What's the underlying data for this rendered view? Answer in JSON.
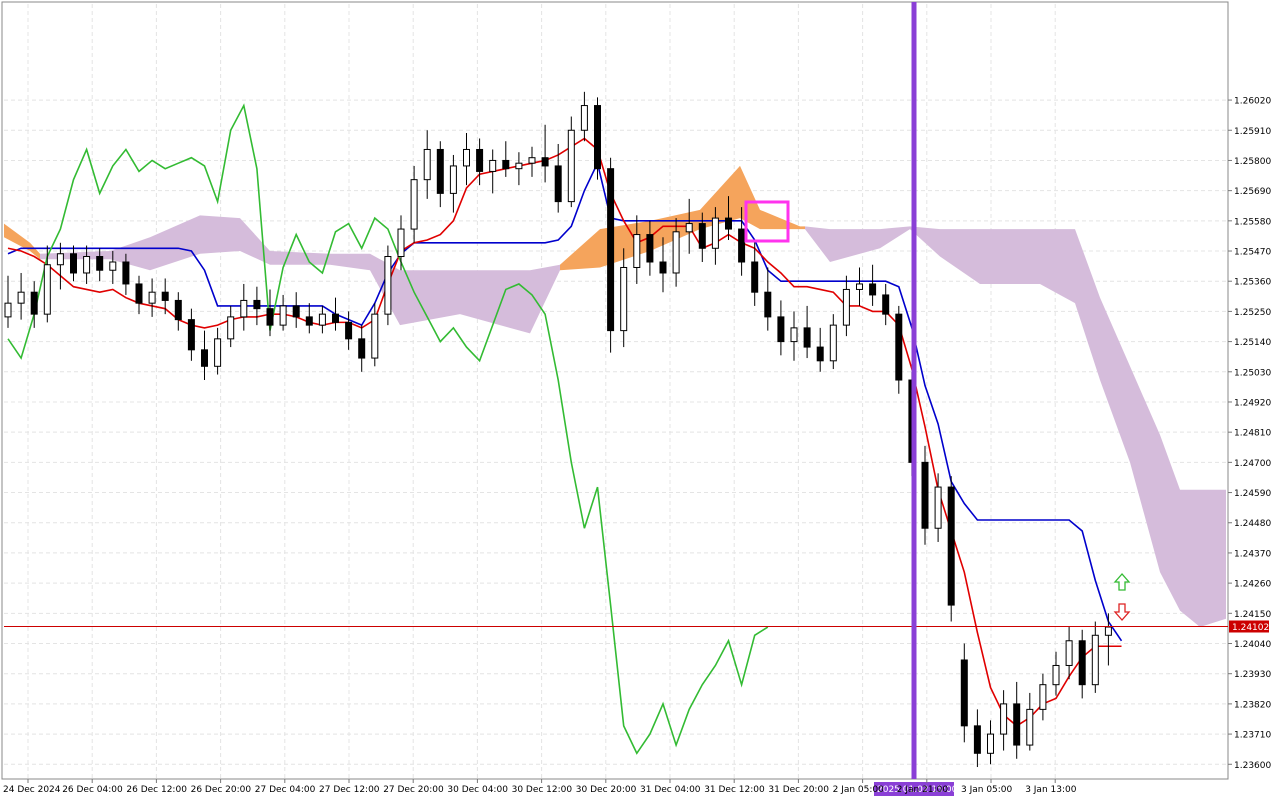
{
  "chart_data": {
    "type": "candlestick",
    "indicator": "Ichimoku Kinko Hyo",
    "grid": true,
    "ylim": [
      1.2355,
      1.2637
    ],
    "y_ticks": [
      "1.26020",
      "1.25910",
      "1.25800",
      "1.25690",
      "1.25580",
      "1.25470",
      "1.25360",
      "1.25250",
      "1.25140",
      "1.25030",
      "1.24920",
      "1.24810",
      "1.24700",
      "1.24590",
      "1.24480",
      "1.24370",
      "1.24260",
      "1.24150",
      "1.24040",
      "1.23930",
      "1.23820",
      "1.23710",
      "1.23600"
    ],
    "x_ticks": [
      "24 Dec 2024",
      "26 Dec 04:00",
      "26 Dec 12:00",
      "26 Dec 20:00",
      "27 Dec 04:00",
      "27 Dec 12:00",
      "27 Dec 20:00",
      "30 Dec 04:00",
      "30 Dec 12:00",
      "30 Dec 20:00",
      "31 Dec 04:00",
      "31 Dec 12:00",
      "31 Dec 20:00",
      "2 Jan 05:00",
      "2 Jan 21:00",
      "3 Jan 05:00",
      "3 Jan 13:00"
    ],
    "current_price": {
      "label": "1.24102",
      "value": 1.24102,
      "color": "#cc0000"
    },
    "vertical_marker": {
      "label": "2025.01.02 15:00",
      "color": "#8a3fd6"
    },
    "highlight_box_color": "#ff33ee",
    "series_colors": {
      "tenkan_sen": "#e00000",
      "kijun_sen": "#0000cc",
      "chikou_span": "#33bb33",
      "kumo_bearish": "#d5bcdb",
      "kumo_bullish": "#f5a45c",
      "candle_bull": "#ffffff",
      "candle_bear": "#000000"
    },
    "arrows": {
      "up_color": "#33bb33",
      "down_color": "#dd2222"
    },
    "candles": [
      [
        1.2523,
        1.2538,
        1.2519,
        1.2528
      ],
      [
        1.2528,
        1.2539,
        1.2522,
        1.2532
      ],
      [
        1.2532,
        1.2536,
        1.2519,
        1.2524
      ],
      [
        1.2524,
        1.2549,
        1.2521,
        1.2542
      ],
      [
        1.2542,
        1.255,
        1.2533,
        1.2546
      ],
      [
        1.2546,
        1.2549,
        1.2536,
        1.2539
      ],
      [
        1.2539,
        1.2549,
        1.2535,
        1.2545
      ],
      [
        1.2545,
        1.2548,
        1.2536,
        1.254
      ],
      [
        1.254,
        1.2547,
        1.2535,
        1.2543
      ],
      [
        1.2543,
        1.2546,
        1.2531,
        1.2535
      ],
      [
        1.2535,
        1.2538,
        1.2524,
        1.2528
      ],
      [
        1.2528,
        1.2537,
        1.2523,
        1.2532
      ],
      [
        1.2532,
        1.2537,
        1.2524,
        1.2529
      ],
      [
        1.2529,
        1.2532,
        1.2518,
        1.2522
      ],
      [
        1.2522,
        1.2526,
        1.2507,
        1.2511
      ],
      [
        1.2511,
        1.2518,
        1.25,
        1.2505
      ],
      [
        1.2505,
        1.2519,
        1.2502,
        1.2515
      ],
      [
        1.2515,
        1.2527,
        1.2512,
        1.2523
      ],
      [
        1.2523,
        1.2535,
        1.2518,
        1.2529
      ],
      [
        1.2529,
        1.2534,
        1.252,
        1.2526
      ],
      [
        1.2526,
        1.2533,
        1.2516,
        1.252
      ],
      [
        1.252,
        1.2531,
        1.2518,
        1.2527
      ],
      [
        1.2527,
        1.2532,
        1.2519,
        1.2523
      ],
      [
        1.2523,
        1.2528,
        1.2517,
        1.252
      ],
      [
        1.252,
        1.2527,
        1.2517,
        1.2524
      ],
      [
        1.2524,
        1.253,
        1.2518,
        1.2521
      ],
      [
        1.2521,
        1.2525,
        1.2511,
        1.2515
      ],
      [
        1.2515,
        1.252,
        1.2503,
        1.2508
      ],
      [
        1.2508,
        1.2528,
        1.2505,
        1.2524
      ],
      [
        1.2524,
        1.2549,
        1.252,
        1.2545
      ],
      [
        1.2545,
        1.256,
        1.254,
        1.2555
      ],
      [
        1.2555,
        1.2578,
        1.255,
        1.2573
      ],
      [
        1.2573,
        1.2591,
        1.2566,
        1.2584
      ],
      [
        1.2584,
        1.2587,
        1.2563,
        1.2568
      ],
      [
        1.2568,
        1.2582,
        1.2561,
        1.2578
      ],
      [
        1.2578,
        1.259,
        1.2571,
        1.2584
      ],
      [
        1.2584,
        1.2588,
        1.2571,
        1.2576
      ],
      [
        1.2576,
        1.2584,
        1.2568,
        1.258
      ],
      [
        1.258,
        1.2587,
        1.2574,
        1.2577
      ],
      [
        1.2577,
        1.2583,
        1.2571,
        1.2579
      ],
      [
        1.2579,
        1.2585,
        1.2574,
        1.2581
      ],
      [
        1.2581,
        1.2593,
        1.2572,
        1.2578
      ],
      [
        1.2578,
        1.2586,
        1.2561,
        1.2565
      ],
      [
        1.2565,
        1.2596,
        1.2563,
        1.2591
      ],
      [
        1.2591,
        1.2605,
        1.2587,
        1.26
      ],
      [
        1.26,
        1.2603,
        1.2573,
        1.2577
      ],
      [
        1.2577,
        1.2581,
        1.251,
        1.2518
      ],
      [
        1.2518,
        1.2548,
        1.2512,
        1.2541
      ],
      [
        1.2541,
        1.256,
        1.2535,
        1.2553
      ],
      [
        1.2553,
        1.2558,
        1.2538,
        1.2543
      ],
      [
        1.2543,
        1.2552,
        1.2532,
        1.2539
      ],
      [
        1.2539,
        1.2559,
        1.2534,
        1.2554
      ],
      [
        1.2554,
        1.2566,
        1.2546,
        1.2557
      ],
      [
        1.2557,
        1.2561,
        1.2543,
        1.2548
      ],
      [
        1.2548,
        1.2563,
        1.2542,
        1.2559
      ],
      [
        1.2559,
        1.2567,
        1.2551,
        1.2555
      ],
      [
        1.2555,
        1.2563,
        1.2538,
        1.2543
      ],
      [
        1.2543,
        1.2551,
        1.2527,
        1.2532
      ],
      [
        1.2532,
        1.2541,
        1.2518,
        1.2523
      ],
      [
        1.2523,
        1.2529,
        1.2509,
        1.2514
      ],
      [
        1.2514,
        1.2525,
        1.2507,
        1.2519
      ],
      [
        1.2519,
        1.2527,
        1.2508,
        1.2512
      ],
      [
        1.2512,
        1.2519,
        1.2503,
        1.2507
      ],
      [
        1.2507,
        1.2524,
        1.2504,
        1.252
      ],
      [
        1.252,
        1.2538,
        1.2516,
        1.2533
      ],
      [
        1.2533,
        1.2541,
        1.2527,
        1.2535
      ],
      [
        1.2535,
        1.2542,
        1.2527,
        1.2531
      ],
      [
        1.2531,
        1.2535,
        1.252,
        1.2524
      ],
      [
        1.2524,
        1.2527,
        1.2495,
        1.25
      ],
      [
        1.25,
        1.2503,
        1.2465,
        1.247
      ],
      [
        1.247,
        1.2476,
        1.244,
        1.2446
      ],
      [
        1.2446,
        1.2466,
        1.2441,
        1.2461
      ],
      [
        1.2461,
        1.2465,
        1.2412,
        1.2418
      ],
      [
        1.2398,
        1.2404,
        1.2368,
        1.2374
      ],
      [
        1.2374,
        1.238,
        1.2359,
        1.2364
      ],
      [
        1.2364,
        1.2376,
        1.236,
        1.2371
      ],
      [
        1.2371,
        1.2387,
        1.2365,
        1.2382
      ],
      [
        1.2382,
        1.239,
        1.2362,
        1.2367
      ],
      [
        1.2367,
        1.2386,
        1.2365,
        1.238
      ],
      [
        1.238,
        1.2393,
        1.2376,
        1.2389
      ],
      [
        1.2389,
        1.2401,
        1.2385,
        1.2396
      ],
      [
        1.2396,
        1.241,
        1.2391,
        1.2405
      ],
      [
        1.2405,
        1.2409,
        1.2384,
        1.2389
      ],
      [
        1.2389,
        1.2412,
        1.2386,
        1.2407
      ],
      [
        1.2407,
        1.2415,
        1.2396,
        1.241
      ]
    ],
    "tenkan_sen": [
      1.2548,
      1.2547,
      1.2545,
      1.2542,
      1.2538,
      1.2534,
      1.2533,
      1.2532,
      1.2533,
      1.253,
      1.2528,
      1.2527,
      1.2526,
      1.2522,
      1.252,
      1.2519,
      1.252,
      1.2522,
      1.2523,
      1.2523,
      1.2524,
      1.2524,
      1.2523,
      1.2521,
      1.252,
      1.2521,
      1.2521,
      1.2519,
      1.2522,
      1.2535,
      1.2547,
      1.255,
      1.2551,
      1.2553,
      1.2558,
      1.257,
      1.2575,
      1.2576,
      1.2577,
      1.2578,
      1.2579,
      1.258,
      1.2582,
      1.2585,
      1.2588,
      1.2584,
      1.2568,
      1.2558,
      1.255,
      1.2552,
      1.2556,
      1.2556,
      1.2556,
      1.2548,
      1.255,
      1.2553,
      1.255,
      1.2548,
      1.2543,
      1.2539,
      1.2534,
      1.2534,
      1.2533,
      1.2532,
      1.2527,
      1.2527,
      1.2525,
      1.2525,
      1.252,
      1.2504,
      1.2483,
      1.246,
      1.2445,
      1.243,
      1.2408,
      1.2388,
      1.2378,
      1.2374,
      1.2377,
      1.2382,
      1.2384,
      1.2392,
      1.2399,
      1.2403,
      1.2403,
      1.2403
    ],
    "kijun_sen": [
      1.2546,
      1.2548,
      1.2548,
      1.2548,
      1.2548,
      1.2548,
      1.2548,
      1.2548,
      1.2548,
      1.2548,
      1.2548,
      1.2548,
      1.2548,
      1.2548,
      1.2547,
      1.254,
      1.2527,
      1.2527,
      1.2527,
      1.2527,
      1.2527,
      1.2527,
      1.2527,
      1.2527,
      1.2527,
      1.2524,
      1.2522,
      1.252,
      1.2528,
      1.2539,
      1.2546,
      1.255,
      1.255,
      1.255,
      1.255,
      1.255,
      1.255,
      1.255,
      1.255,
      1.255,
      1.255,
      1.255,
      1.2551,
      1.2556,
      1.2569,
      1.2579,
      1.2559,
      1.2558,
      1.2558,
      1.2558,
      1.2558,
      1.2558,
      1.2558,
      1.2558,
      1.2558,
      1.2558,
      1.2558,
      1.2551,
      1.254,
      1.2536,
      1.2536,
      1.2536,
      1.2536,
      1.2536,
      1.2536,
      1.2536,
      1.2536,
      1.2536,
      1.2534,
      1.2519,
      1.2498,
      1.2484,
      1.2463,
      1.2455,
      1.2449,
      1.2449,
      1.2449,
      1.2449,
      1.2449,
      1.2449,
      1.2449,
      1.2449,
      1.2445,
      1.2427,
      1.2412,
      1.2405
    ]
  }
}
